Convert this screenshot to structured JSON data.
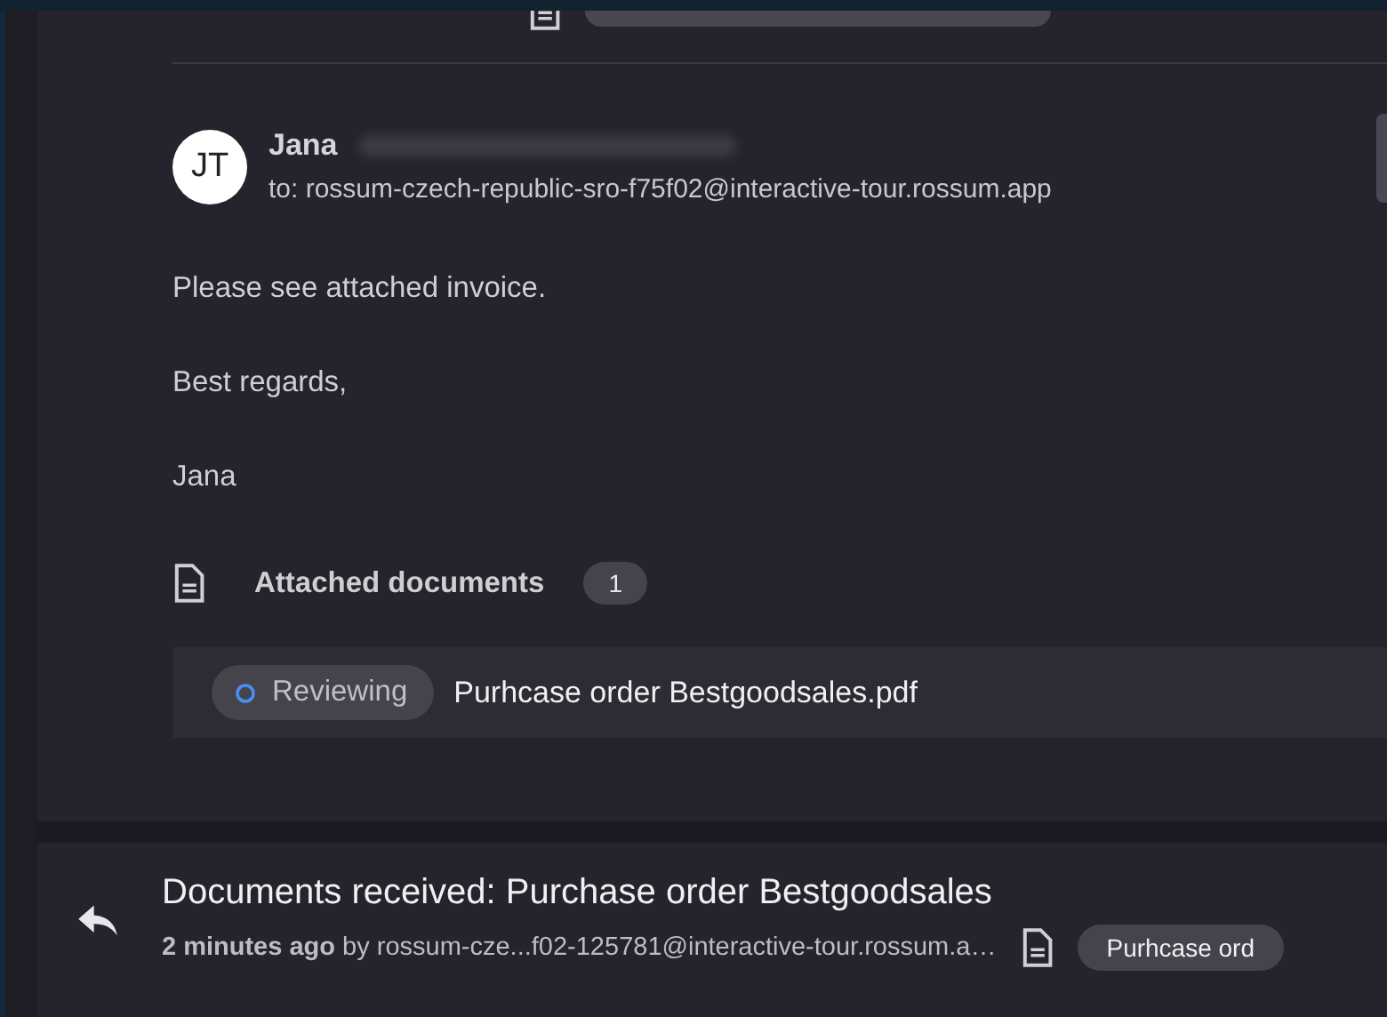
{
  "message": {
    "sender": "Jana",
    "avatar_initials": "JT",
    "recipient": "to: rossum-czech-republic-sro-f75f02@interactive-tour.rossum.app",
    "body": [
      "Please see attached invoice.",
      "Best regards,",
      "Jana"
    ],
    "attachments_label": "Attached documents",
    "attachments_count": "1",
    "documents": [
      {
        "status": "Reviewing",
        "name": "Purhcase order Bestgoodsales.pdf"
      }
    ]
  },
  "next_message": {
    "subject": "Documents received: Purchase order Bestgoodsales",
    "meta": "**2 minutes ago** by rossum-cze...f02-125781@interactive-tour.rossum.a…",
    "document_chip": "Purhcase ord"
  }
}
